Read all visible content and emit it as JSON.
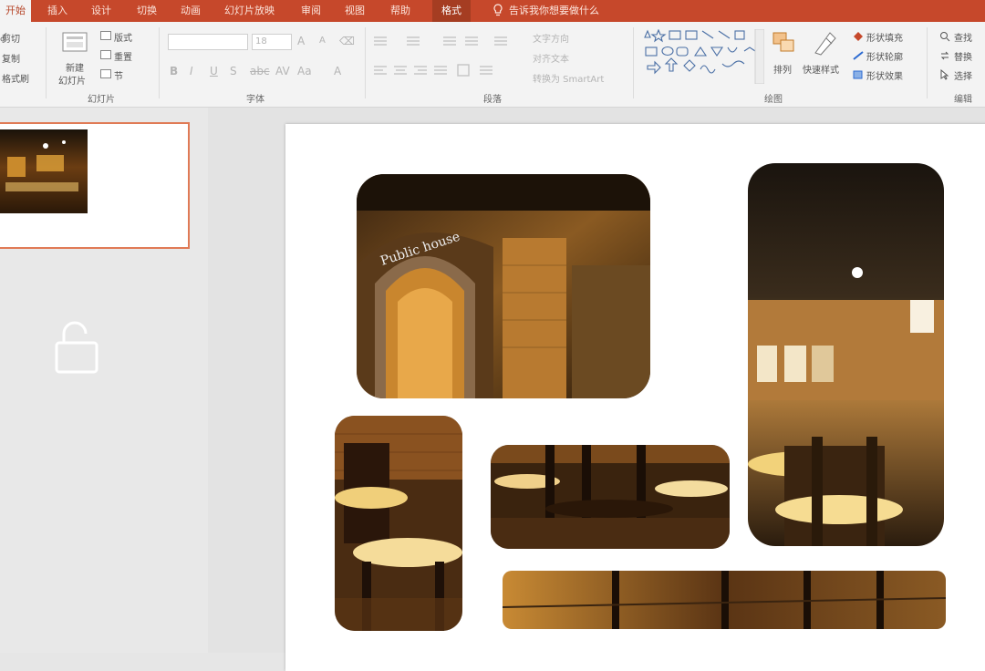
{
  "tabs": [
    {
      "label": "开始",
      "active": true
    },
    {
      "label": "插入"
    },
    {
      "label": "设计"
    },
    {
      "label": "切换"
    },
    {
      "label": "动画"
    },
    {
      "label": "幻灯片放映"
    },
    {
      "label": "审阅"
    },
    {
      "label": "视图"
    },
    {
      "label": "帮助"
    },
    {
      "label": "格式",
      "context": true
    }
  ],
  "tell_me": "告诉我你想要做什么",
  "ribbon": {
    "clipboard": {
      "cut": "剪切",
      "copy": "复制",
      "format_painter": "格式刷"
    },
    "slides": {
      "new_slide_1": "新建",
      "new_slide_2": "幻灯片",
      "layout": "版式",
      "reset": "重置",
      "section": "节",
      "group_label": "幻灯片"
    },
    "font": {
      "group_label": "字体",
      "size": "18"
    },
    "paragraph": {
      "group_label": "段落",
      "text_direction": "文字方向",
      "align_text": "对齐文本",
      "smartart": "转换为 SmartArt"
    },
    "drawing": {
      "group_label": "绘图",
      "arrange": "排列",
      "quick_styles": "快速样式",
      "shape_fill": "形状填充",
      "shape_outline": "形状轮廓",
      "shape_effects": "形状效果"
    },
    "editing": {
      "group_label": "编辑",
      "find": "查找",
      "replace": "替换",
      "select": "选择"
    }
  },
  "colors": {
    "tab_bar": "#c6482b",
    "ribbon": "#f3f3f3",
    "accent": "#e07a55",
    "slide": "#ffffff"
  },
  "icons": [
    "lightbulb-icon",
    "lock-icon",
    "scissors-icon",
    "copy-icon",
    "format-painter-icon"
  ]
}
